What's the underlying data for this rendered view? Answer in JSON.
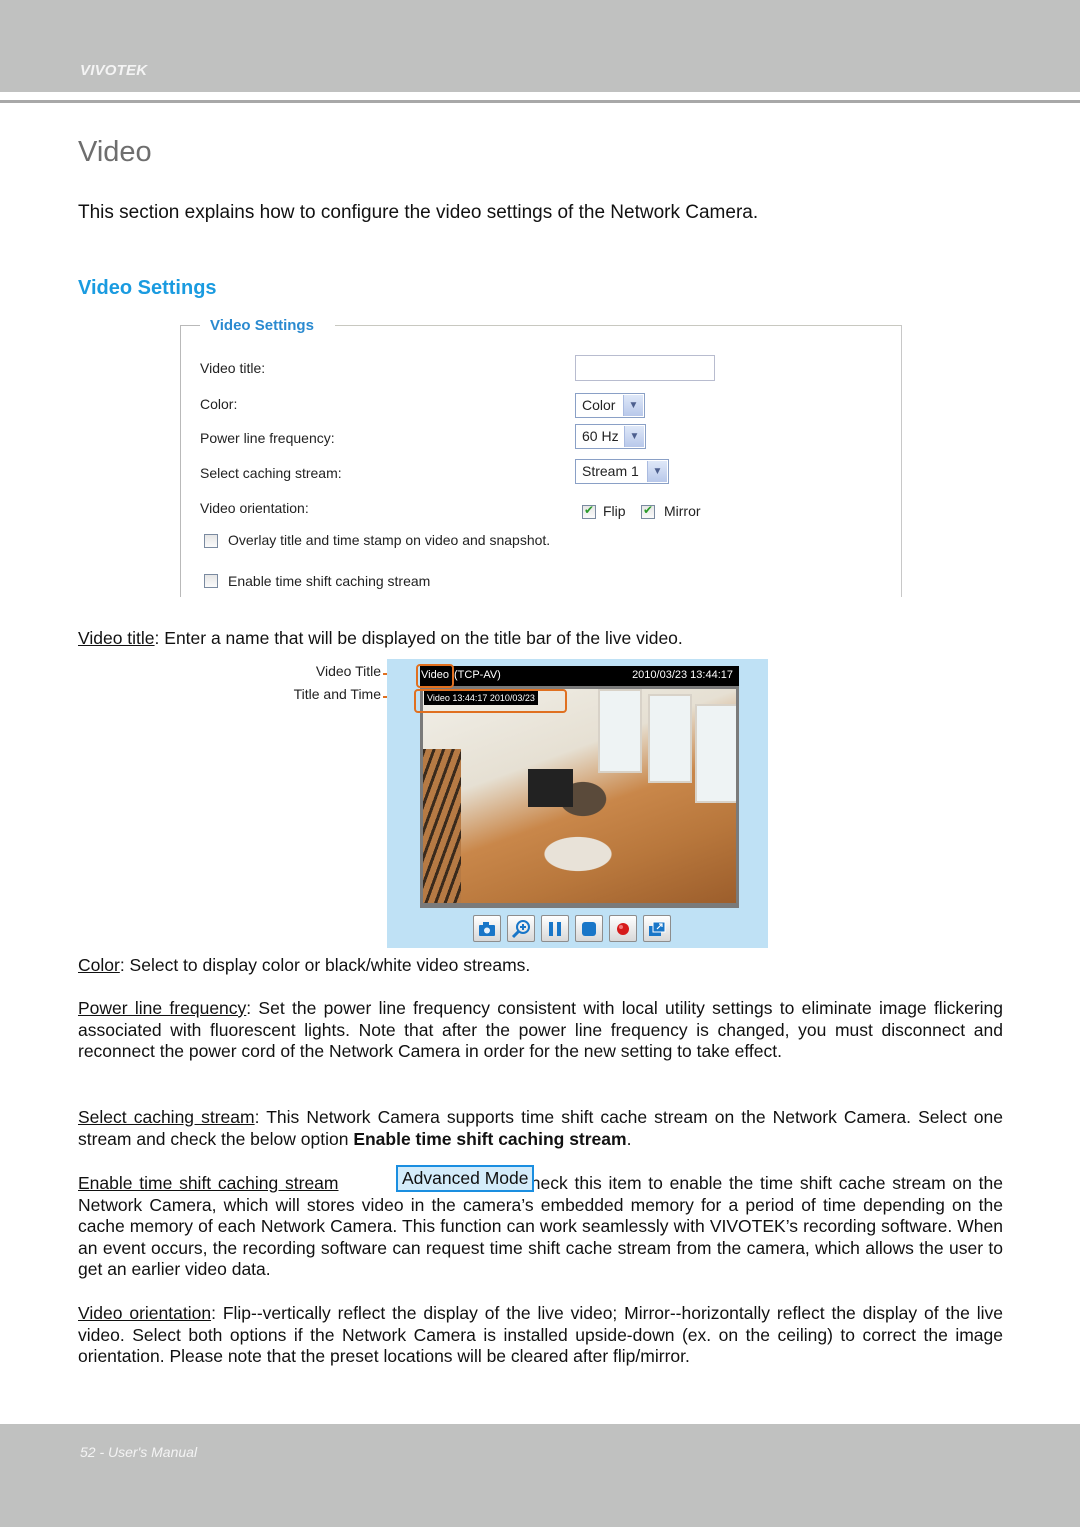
{
  "header": {
    "brand": "VIVOTEK"
  },
  "page": {
    "title": "Video",
    "intro": "This section explains how to configure the video settings of the Network Camera.",
    "section_heading": "Video Settings"
  },
  "settings_panel": {
    "legend": "Video Settings",
    "video_title": {
      "label": "Video title:",
      "value": ""
    },
    "color": {
      "label": "Color:",
      "selected": "Color"
    },
    "power_line_frequency": {
      "label": "Power line frequency:",
      "selected": "60 Hz"
    },
    "caching_stream": {
      "label": "Select caching stream:",
      "selected": "Stream 1"
    },
    "orientation": {
      "label": "Video orientation:",
      "flip": {
        "label": "Flip",
        "checked": true
      },
      "mirror": {
        "label": "Mirror",
        "checked": true
      }
    },
    "overlay": {
      "label": "Overlay title and time stamp on video and snapshot.",
      "checked": false
    },
    "time_shift": {
      "label": "Enable time shift caching stream",
      "checked": false
    }
  },
  "para_video_title": {
    "term": "Video title",
    "text": ": Enter a name that will be displayed on the title bar of the live video."
  },
  "camera_view": {
    "callout_video_title": "Video Title",
    "callout_title_time": "Title and Time",
    "titlebar_title": "Video",
    "titlebar_protocol": "(TCP-AV)",
    "titlebar_datetime": "2010/03/23 13:44:17",
    "overlay_text": "Video 13:44:17  2010/03/23",
    "toolbar": [
      "snapshot",
      "digital-zoom",
      "pause",
      "stop",
      "record",
      "fullscreen"
    ]
  },
  "para_color": {
    "term": "Color",
    "text": ": Select to display color or black/white video streams."
  },
  "para_power": {
    "term": "Power line frequency",
    "text": ": Set the power line frequency consistent with local utility settings to eliminate image flickering associated with fluorescent lights. Note that after the power line frequency is changed, you must disconnect and reconnect the power cord of the Network Camera in order for the new setting to take effect."
  },
  "para_caching": {
    "term": "Select caching stream",
    "text": ": This Network Camera supports time shift cache stream on the Network Camera. Select one stream and check the below option ",
    "bold": "Enable time shift caching stream",
    "end": "."
  },
  "para_timeshift": {
    "term": "Enable time shift caching stream",
    "badge": "Advanced Mode",
    "text": ": Check this item to enable the time shift cache stream on the Network Camera, which will stores video in the camera’s embedded memory for a period of time depending on the cache memory of each Network Camera. This function can work seamlessly with VIVOTEK’s recording software. When an event occurs, the recording software can request time shift cache stream from the camera, which allows the user to get an earlier video data."
  },
  "para_orientation": {
    "term": "Video orientation",
    "text": ": Flip--vertically reflect the display of the live video; Mirror--horizontally reflect the display of the live video. Select both options if the Network Camera is installed upside-down (ex. on the ceiling) to correct the image orientation.  Please note that the preset locations will be cleared after flip/mirror."
  },
  "footer": {
    "text": "52 - User's Manual"
  },
  "colors": {
    "accent": "#1a9be0",
    "callout": "#e07020",
    "band": "#c0c1c0"
  }
}
